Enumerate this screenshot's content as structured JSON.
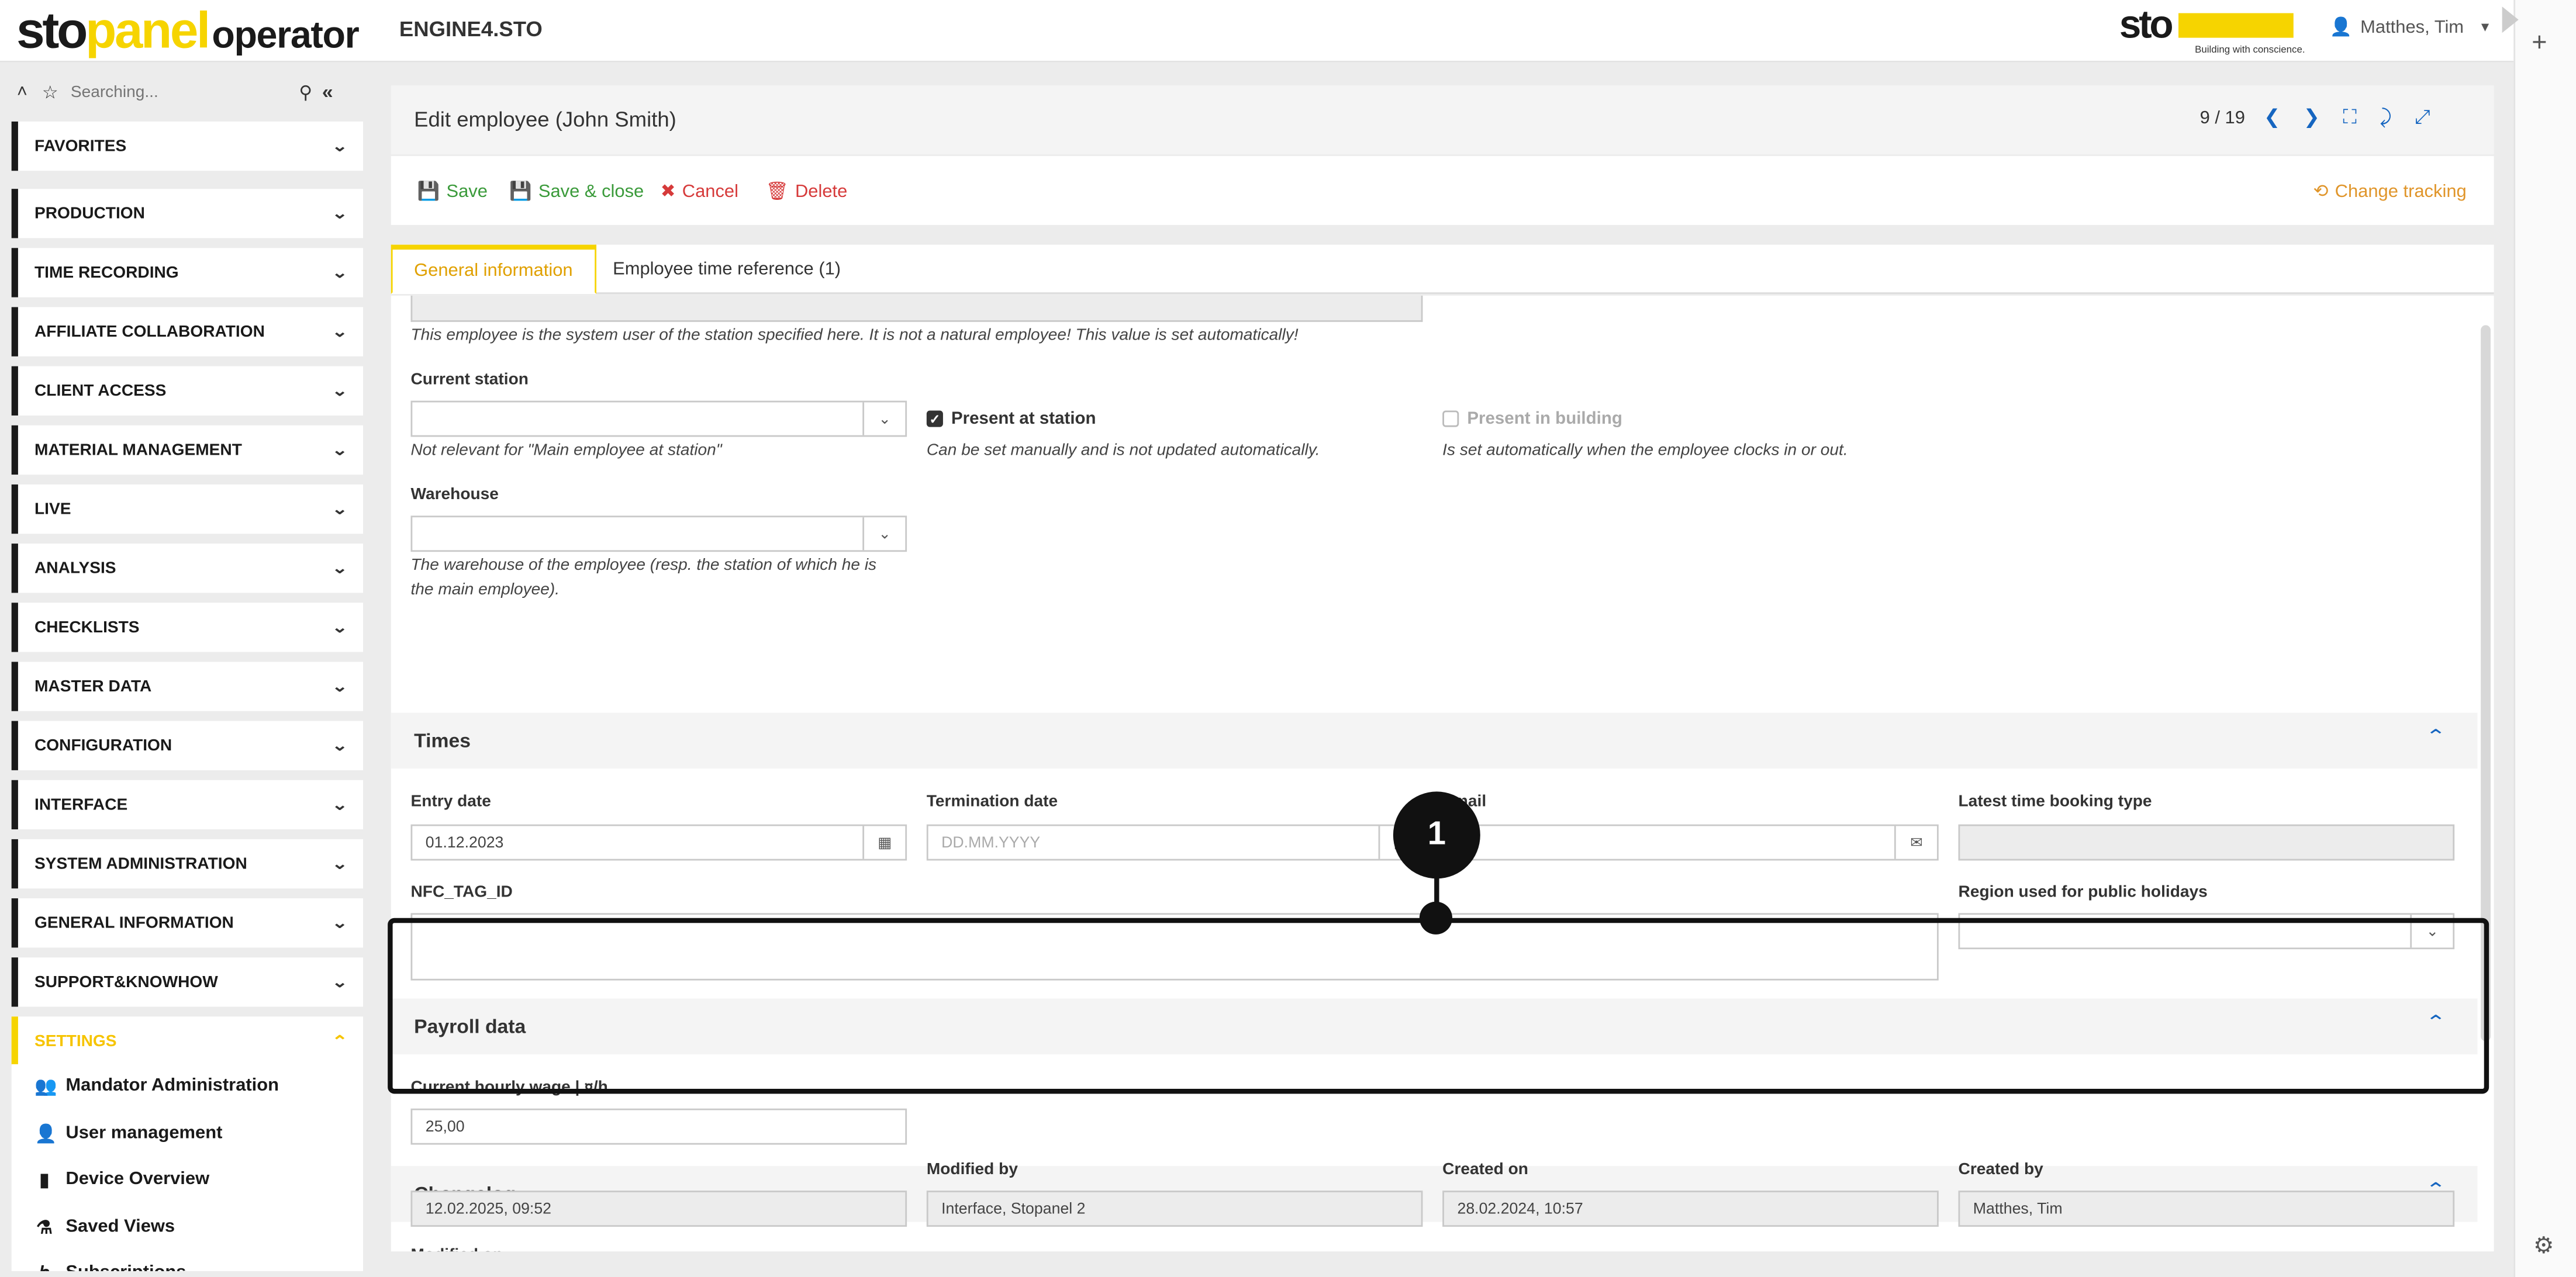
{
  "app": {
    "logo_part1": "sto",
    "logo_part2": "panel",
    "logo_part3": "operator",
    "environment": "ENGINE4.STO",
    "brand": "sto",
    "brand_slogan": "Building with conscience.",
    "user_name": "Matthes, Tim"
  },
  "sidebar": {
    "search_placeholder": "Searching...",
    "items": [
      {
        "label": "FAVORITES"
      },
      {
        "label": "PRODUCTION"
      },
      {
        "label": "TIME RECORDING"
      },
      {
        "label": "AFFILIATE COLLABORATION"
      },
      {
        "label": "CLIENT ACCESS"
      },
      {
        "label": "MATERIAL MANAGEMENT"
      },
      {
        "label": "LIVE"
      },
      {
        "label": "ANALYSIS"
      },
      {
        "label": "CHECKLISTS"
      },
      {
        "label": "MASTER DATA"
      },
      {
        "label": "CONFIGURATION"
      },
      {
        "label": "INTERFACE"
      },
      {
        "label": "SYSTEM ADMINISTRATION"
      },
      {
        "label": "GENERAL INFORMATION"
      },
      {
        "label": "SUPPORT&KNOWHOW"
      },
      {
        "label": "SETTINGS"
      }
    ],
    "settings_sub": [
      {
        "label": "Mandator Administration",
        "icon": "user-gear-icon"
      },
      {
        "label": "User management",
        "icon": "user-icon"
      },
      {
        "label": "Device Overview",
        "icon": "device-icon"
      },
      {
        "label": "Saved Views",
        "icon": "saved-views-icon"
      },
      {
        "label": "Subscriptions",
        "icon": "subscription-icon"
      }
    ]
  },
  "header": {
    "title": "Edit employee (John Smith)",
    "pager": "9 / 19"
  },
  "toolbar": {
    "save": "Save",
    "save_close": "Save & close",
    "cancel": "Cancel",
    "delete": "Delete",
    "change_tracking": "Change tracking"
  },
  "tabs": {
    "general": "General information",
    "time_reference": "Employee time reference (1)"
  },
  "form": {
    "system_user_note": "This employee is the system user of the station specified here. It is not a natural employee! This value is set automatically!",
    "current_station_label": "Current station",
    "current_station_note": "Not relevant for \"Main employee at station\"",
    "present_at_station_label": "Present at station",
    "present_at_station_note": "Can be set manually and is not updated automatically.",
    "present_in_building_label": "Present in building",
    "present_in_building_note": "Is set automatically when the employee clocks in or out.",
    "warehouse_label": "Warehouse",
    "warehouse_note": "The warehouse of the employee (resp. the station of which he is the main employee)."
  },
  "times": {
    "title": "Times",
    "entry_date_label": "Entry date",
    "entry_date_value": "01.12.2023",
    "termination_date_label": "Termination date",
    "termination_date_placeholder": "DD.MM.YYYY",
    "email_label": "Email",
    "latest_booking_label": "Latest time booking type",
    "nfc_label": "NFC_TAG_ID",
    "region_label": "Region used for public holidays"
  },
  "payroll": {
    "title": "Payroll data",
    "wage_label": "Current hourly wage | ¤/h",
    "wage_value": "25,00"
  },
  "changelog": {
    "title": "Changelog",
    "modified_on_label": "Modified on",
    "modified_on_value": "12.02.2025, 09:52",
    "modified_by_label": "Modified by",
    "modified_by_value": "Interface, Stopanel 2",
    "created_on_label": "Created on",
    "created_on_value": "28.02.2024, 10:57",
    "created_by_label": "Created by",
    "created_by_value": "Matthes, Tim"
  },
  "callout": {
    "number": "1"
  },
  "colors": {
    "brand_yellow": "#f6d400",
    "link_blue": "#1565c0",
    "save_green": "#3a9a3a",
    "cancel_red": "#d63a3a",
    "tracking_orange": "#e0952a"
  }
}
